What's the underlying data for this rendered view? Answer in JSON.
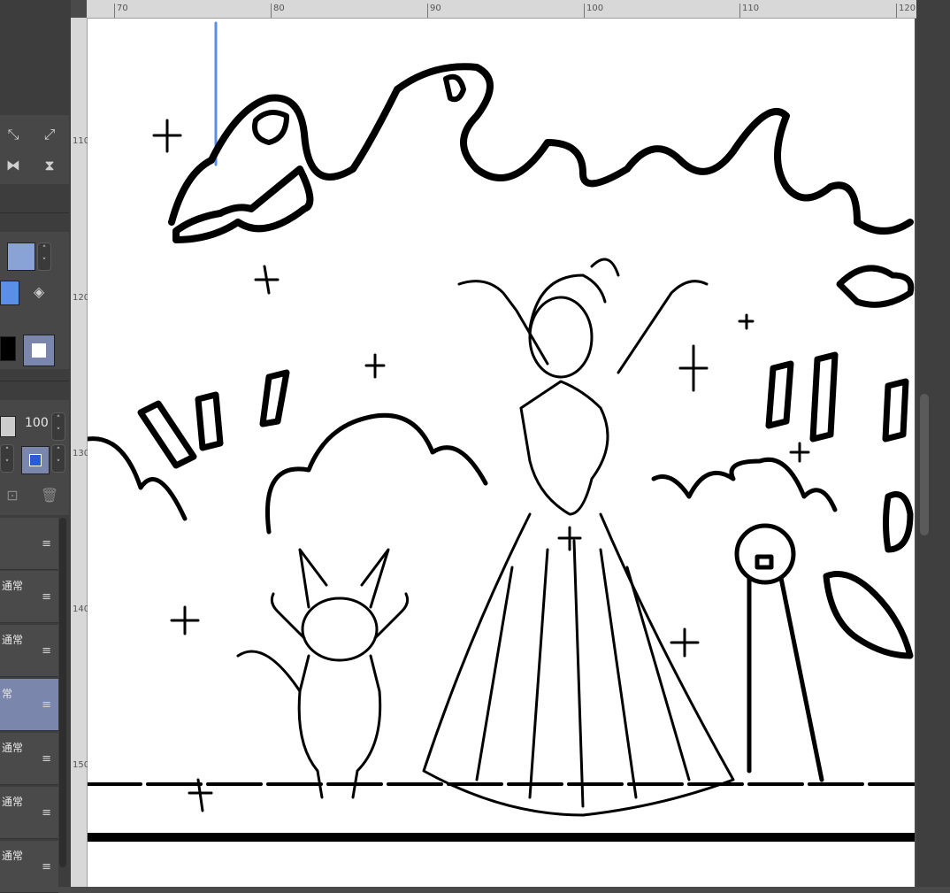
{
  "ruler": {
    "top_labels": [
      "70",
      "80",
      "90",
      "100",
      "110",
      "120"
    ],
    "left_labels": [
      "110",
      "120",
      "130",
      "140",
      "150"
    ]
  },
  "palette": {
    "opacity_value": "100",
    "colors": {
      "main": "#5b8ee6",
      "black": "#000000",
      "white": "#ffffff",
      "selected_layer": "#7b86ad"
    }
  },
  "layers": [
    {
      "label": ""
    },
    {
      "label": "通常"
    },
    {
      "label": "通常"
    },
    {
      "label": "常"
    },
    {
      "label": "通常"
    },
    {
      "label": "通常"
    },
    {
      "label": "通常"
    }
  ],
  "icons": [
    "transform-icon",
    "fit-icon",
    "flip-horizontal-icon",
    "flip-vertical-icon",
    "fill-icon",
    "menu-icon",
    "trash-icon"
  ]
}
